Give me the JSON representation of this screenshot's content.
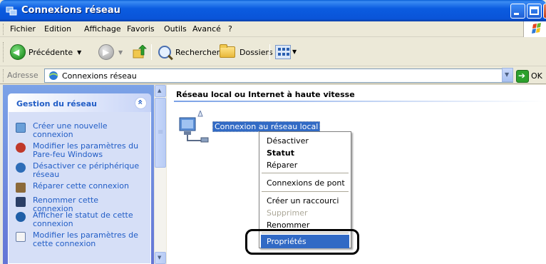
{
  "window": {
    "title": "Connexions réseau",
    "controls": [
      "minimize",
      "maximize",
      "close"
    ]
  },
  "menubar": {
    "items": [
      {
        "label": "Fichier"
      },
      {
        "label": "Edition"
      },
      {
        "label": "Affichage"
      },
      {
        "label": "Favoris"
      },
      {
        "label": "Outils"
      },
      {
        "label": "Avancé"
      },
      {
        "label": "?"
      }
    ]
  },
  "toolbar": {
    "back_label": "Précédente",
    "search_label": "Rechercher",
    "folders_label": "Dossiers"
  },
  "address": {
    "label": "Adresse",
    "value": "Connexions réseau",
    "go_label": "OK"
  },
  "taskpane": {
    "header": "Gestion du réseau",
    "tasks": [
      {
        "label": "Créer une nouvelle connexion",
        "icon": "new-connection-icon"
      },
      {
        "label": "Modifier les paramètres du Pare-feu Windows",
        "icon": "firewall-icon"
      },
      {
        "label": "Désactiver ce périphérique réseau",
        "icon": "disable-device-icon"
      },
      {
        "label": "Réparer cette connexion",
        "icon": "repair-icon"
      },
      {
        "label": "Renommer cette connexion",
        "icon": "rename-icon"
      },
      {
        "label": "Afficher le statut de cette connexion",
        "icon": "status-icon"
      },
      {
        "label": "Modifier les paramètres de cette connexion",
        "icon": "properties-icon"
      }
    ]
  },
  "content": {
    "group_title": "Réseau local ou Internet à haute vitesse",
    "connection_label": "Connexion au réseau local"
  },
  "context_menu": {
    "items": [
      {
        "label": "Désactiver"
      },
      {
        "label": "Statut"
      },
      {
        "label": "Réparer"
      },
      {
        "label": "Connexions de pont"
      },
      {
        "label": "Créer un raccourci"
      },
      {
        "label": "Supprimer"
      },
      {
        "label": "Renommer"
      },
      {
        "label": "Propriétés"
      }
    ]
  },
  "colors": {
    "titlebar": "#0a54d8",
    "selection": "#316ac5",
    "taskpane_bg": "#7ba2e7",
    "task_link": "#215dc6"
  }
}
